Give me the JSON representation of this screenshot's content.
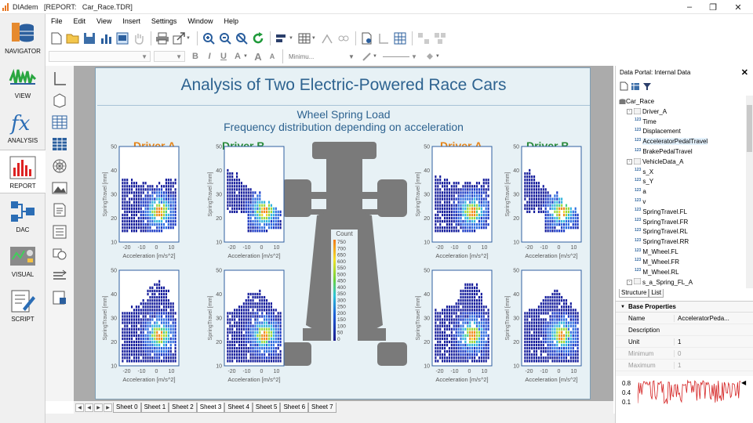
{
  "window": {
    "title": "DIAdem   [REPORT:   Car_Race.TDR]"
  },
  "panels": [
    {
      "label": "NAVIGATOR",
      "icon": "navigator-icon"
    },
    {
      "label": "VIEW",
      "icon": "view-icon"
    },
    {
      "label": "ANALYSIS",
      "icon": "analysis-icon"
    },
    {
      "label": "REPORT",
      "icon": "report-icon"
    },
    {
      "label": "DAC",
      "icon": "dac-icon"
    },
    {
      "label": "VISUAL",
      "icon": "visual-icon"
    },
    {
      "label": "SCRIPT",
      "icon": "script-icon"
    }
  ],
  "menu": [
    "File",
    "Edit",
    "View",
    "Insert",
    "Settings",
    "Window",
    "Help"
  ],
  "toolbar2": {
    "bold": "B",
    "italic": "I",
    "underline": "U",
    "font_size_up": "A",
    "font_size_down": "A",
    "line_width": "Minimu..."
  },
  "report": {
    "title": "Analysis of Two Electric-Powered Race Cars",
    "subtitle1": "Wheel Spring Load",
    "subtitle2": "Frequency distribution depending on acceleration",
    "driver_a": "Driver A",
    "driver_b": "Driver B",
    "colorbar": {
      "title": "Count",
      "ticks": [
        "750",
        "700",
        "650",
        "600",
        "550",
        "500",
        "450",
        "400",
        "350",
        "300",
        "250",
        "200",
        "150",
        "100",
        "50",
        "0"
      ]
    }
  },
  "chart_data": [
    {
      "type": "heatmap",
      "title": "",
      "series_label": "Driver A",
      "xlabel": "Acceleration [m/s^2]",
      "ylabel": "SpringTravel [mm]",
      "xticks": [
        "-20",
        "-10",
        "0",
        "10"
      ],
      "yticks": [
        "50",
        "40",
        "30",
        "20",
        "10"
      ],
      "xlim": [
        -25,
        15
      ],
      "ylim": [
        10,
        50
      ]
    },
    {
      "type": "heatmap",
      "title": "",
      "series_label": "Driver B",
      "xlabel": "Acceleration [m/s^2]",
      "ylabel": "SpringTravel [mm]",
      "xticks": [
        "-20",
        "-10",
        "0",
        "10"
      ],
      "yticks": [
        "50",
        "40",
        "30",
        "20",
        "10"
      ],
      "xlim": [
        -25,
        15
      ],
      "ylim": [
        10,
        50
      ]
    },
    {
      "type": "heatmap",
      "title": "",
      "series_label": "Driver A",
      "xlabel": "Acceleration [m/s^2]",
      "ylabel": "SpringTravel [mm]",
      "xticks": [
        "-20",
        "-10",
        "0",
        "10"
      ],
      "yticks": [
        "50",
        "40",
        "30",
        "20",
        "10"
      ],
      "xlim": [
        -25,
        15
      ],
      "ylim": [
        10,
        50
      ]
    },
    {
      "type": "heatmap",
      "title": "",
      "series_label": "Driver B",
      "xlabel": "Acceleration [m/s^2]",
      "ylabel": "SpringTravel [mm]",
      "xticks": [
        "-20",
        "-10",
        "0",
        "10"
      ],
      "yticks": [
        "50",
        "40",
        "30",
        "20",
        "10"
      ],
      "xlim": [
        -25,
        15
      ],
      "ylim": [
        10,
        50
      ]
    },
    {
      "type": "heatmap",
      "title": "",
      "series_label": "Driver A",
      "xlabel": "Acceleration [m/s^2]",
      "ylabel": "SpringTravel [mm]",
      "xticks": [
        "-20",
        "-10",
        "0",
        "10"
      ],
      "yticks": [
        "50",
        "40",
        "30",
        "20",
        "10"
      ],
      "xlim": [
        -25,
        15
      ],
      "ylim": [
        10,
        50
      ]
    },
    {
      "type": "heatmap",
      "title": "",
      "series_label": "Driver B",
      "xlabel": "Acceleration [m/s^2]",
      "ylabel": "SpringTravel [mm]",
      "xticks": [
        "-20",
        "-10",
        "0",
        "10"
      ],
      "yticks": [
        "50",
        "40",
        "30",
        "20",
        "10"
      ],
      "xlim": [
        -25,
        15
      ],
      "ylim": [
        10,
        50
      ]
    },
    {
      "type": "heatmap",
      "title": "",
      "series_label": "Driver A",
      "xlabel": "Acceleration [m/s^2]",
      "ylabel": "SpringTravel [mm]",
      "xticks": [
        "-20",
        "-10",
        "0",
        "10"
      ],
      "yticks": [
        "50",
        "40",
        "30",
        "20",
        "10"
      ],
      "xlim": [
        -25,
        15
      ],
      "ylim": [
        10,
        50
      ]
    },
    {
      "type": "heatmap",
      "title": "",
      "series_label": "Driver B",
      "xlabel": "Acceleration [m/s^2]",
      "ylabel": "SpringTravel [mm]",
      "xticks": [
        "-20",
        "-10",
        "0",
        "10"
      ],
      "yticks": [
        "50",
        "40",
        "30",
        "20",
        "10"
      ],
      "xlim": [
        -25,
        15
      ],
      "ylim": [
        10,
        50
      ]
    }
  ],
  "sheet_tabs": [
    "Sheet 0",
    "Sheet 1",
    "Sheet 2",
    "Sheet 3",
    "Sheet 4",
    "Sheet 5",
    "Sheet 6",
    "Sheet 7"
  ],
  "data_portal": {
    "title": "Data Portal: Internal Data",
    "tree": [
      {
        "label": "Car_Race",
        "level": 0,
        "kind": "root"
      },
      {
        "label": "Driver_A",
        "level": 1,
        "kind": "group"
      },
      {
        "label": "Time",
        "level": 2,
        "kind": "channel"
      },
      {
        "label": "Displacement",
        "level": 2,
        "kind": "channel"
      },
      {
        "label": "AcceleratorPedalTravel",
        "level": 2,
        "kind": "channel",
        "selected": true
      },
      {
        "label": "BrakePedalTravel",
        "level": 2,
        "kind": "channel"
      },
      {
        "label": "VehicleData_A",
        "level": 1,
        "kind": "group"
      },
      {
        "label": "s_X",
        "level": 2,
        "kind": "channel"
      },
      {
        "label": "s_Y",
        "level": 2,
        "kind": "channel"
      },
      {
        "label": "a",
        "level": 2,
        "kind": "channel"
      },
      {
        "label": "v",
        "level": 2,
        "kind": "channel"
      },
      {
        "label": "SpringTravel.FL",
        "level": 2,
        "kind": "channel"
      },
      {
        "label": "SpringTravel.FR",
        "level": 2,
        "kind": "channel"
      },
      {
        "label": "SpringTravel.RL",
        "level": 2,
        "kind": "channel"
      },
      {
        "label": "SpringTravel.RR",
        "level": 2,
        "kind": "channel"
      },
      {
        "label": "M_Wheel.FL",
        "level": 2,
        "kind": "channel"
      },
      {
        "label": "M_Wheel.FR",
        "level": 2,
        "kind": "channel"
      },
      {
        "label": "M_Wheel.RL",
        "level": 2,
        "kind": "channel"
      },
      {
        "label": "s_a_Spring_FL_A",
        "level": 1,
        "kind": "group"
      }
    ],
    "tabs": [
      "Structure",
      "List"
    ],
    "properties": {
      "title": "Base Properties",
      "rows": [
        {
          "name": "Name",
          "value": "AcceleratorPeda..."
        },
        {
          "name": "Description",
          "value": ""
        },
        {
          "name": "Unit",
          "value": "1"
        },
        {
          "name": "Minimum",
          "value": "0"
        },
        {
          "name": "Maximum",
          "value": "1"
        }
      ]
    },
    "preview": {
      "ticks": [
        "0.8",
        "0.4",
        "0.1"
      ]
    }
  },
  "colors": {
    "report_title": "#2e6390",
    "driver_a": "#e58419",
    "driver_b": "#2a8a3a",
    "heat_low": "#1a2fb0",
    "heat_high": "#ff8c00"
  }
}
